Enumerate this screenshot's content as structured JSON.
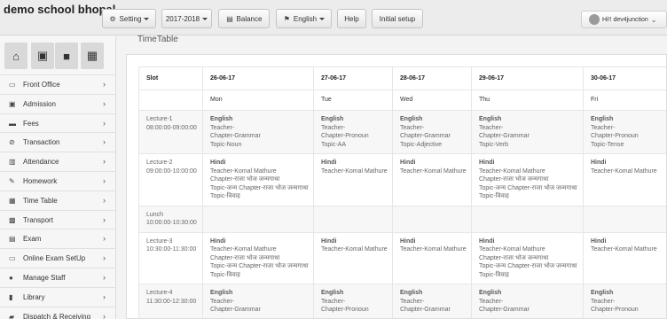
{
  "app": {
    "brand": "demo school bhopal"
  },
  "toolbar": {
    "setting": "Setting",
    "session": "2017-2018",
    "balance": "Balance",
    "language": "English",
    "help": "Help",
    "initial_setup": "Initial setup"
  },
  "user": {
    "greeting": "Hi!! dev4junction"
  },
  "sidebar": {
    "items": [
      {
        "label": "Front Office",
        "icon": "monitor-icon"
      },
      {
        "label": "Admission",
        "icon": "id-card-icon"
      },
      {
        "label": "Fees",
        "icon": "money-icon"
      },
      {
        "label": "Transaction",
        "icon": "link-icon"
      },
      {
        "label": "Attendance",
        "icon": "bar-chart-icon"
      },
      {
        "label": "Homework",
        "icon": "pencil-icon"
      },
      {
        "label": "Time Table",
        "icon": "calendar-icon"
      },
      {
        "label": "Transport",
        "icon": "bus-icon"
      },
      {
        "label": "Exam",
        "icon": "file-icon"
      },
      {
        "label": "Online Exam SetUp",
        "icon": "monitor-icon"
      },
      {
        "label": "Manage Staff",
        "icon": "users-icon"
      },
      {
        "label": "Library",
        "icon": "book-icon"
      },
      {
        "label": "Dispatch & Receiving",
        "icon": "truck-icon"
      }
    ]
  },
  "page": {
    "title": "TimeTable"
  },
  "timetable": {
    "slot_header": "Slot",
    "dates": [
      "26-06-17",
      "27-06-17",
      "28-06-17",
      "29-06-17",
      "30-06-17"
    ],
    "days": [
      "Mon",
      "Tue",
      "Wed",
      "Thu",
      "Fri"
    ],
    "rows": [
      {
        "slot": "Lecture-1",
        "time": "08:00:00-09:00:00",
        "cells": [
          [
            "English",
            "Teacher-",
            "Chapter-Grammar",
            "Topic-Noun"
          ],
          [
            "English",
            "Teacher-",
            "Chapter-Pronoun",
            "Topic-AA"
          ],
          [
            "English",
            "Teacher-",
            "Chapter-Grammar",
            "Topic-Adjective"
          ],
          [
            "English",
            "Teacher-",
            "Chapter-Grammar",
            "Topic-Verb"
          ],
          [
            "English",
            "Teacher-",
            "Chapter-Pronoun",
            "Topic-Tense"
          ]
        ]
      },
      {
        "slot": "Lecture-2",
        "time": "09:00:00-10:00:00",
        "cells": [
          [
            "Hindi",
            "Teacher-Komal Mathure",
            "Chapter-राजा भोज जन्मगाथा",
            "Topic-जन्म Chapter-राजा भोज जन्मगाथा",
            "Topic-विवाह"
          ],
          [
            "Hindi",
            "Teacher-Komal Mathure"
          ],
          [
            "Hindi",
            "Teacher-Komal Mathure"
          ],
          [
            "Hindi",
            "Teacher-Komal Mathure",
            "Chapter-राजा भोज जन्मगाथा",
            "Topic-जन्म Chapter-राजा भोज जन्मगाथा",
            "Topic-विवाह"
          ],
          [
            "Hindi",
            "Teacher-Komal Mathure"
          ]
        ]
      },
      {
        "slot": "Lunch",
        "time": "10:00:00-10:30:00",
        "cells": [
          [],
          [],
          [],
          [],
          []
        ]
      },
      {
        "slot": "Lecture-3",
        "time": "10:30:00-11:30:00",
        "cells": [
          [
            "Hindi",
            "Teacher-Komal Mathure",
            "Chapter-राजा भोज जन्मगाथा",
            "Topic-जन्म Chapter-राजा भोज जन्मगाथा",
            "Topic-विवाह"
          ],
          [
            "Hindi",
            "Teacher-Komal Mathure"
          ],
          [
            "Hindi",
            "Teacher-Komal Mathure"
          ],
          [
            "Hindi",
            "Teacher-Komal Mathure",
            "Chapter-राजा भोज जन्मगाथा",
            "Topic-जन्म Chapter-राजा भोज जन्मगाथा",
            "Topic-विवाह"
          ],
          [
            "Hindi",
            "Teacher-Komal Mathure"
          ]
        ]
      },
      {
        "slot": "Lecture-4",
        "time": "11:30:00-12:30:00",
        "cells": [
          [
            "English",
            "Teacher-",
            "Chapter-Grammar"
          ],
          [
            "English",
            "Teacher-",
            "Chapter-Pronoun"
          ],
          [
            "English",
            "Teacher-",
            "Chapter-Grammar"
          ],
          [
            "English",
            "Teacher-",
            "Chapter-Grammar"
          ],
          [
            "English",
            "Teacher-",
            "Chapter-Pronoun"
          ]
        ]
      }
    ]
  },
  "colors": {
    "topbar": "#ececec",
    "sidebar": "#f6f6f6",
    "panel": "#ffffff",
    "text": "#555555"
  }
}
